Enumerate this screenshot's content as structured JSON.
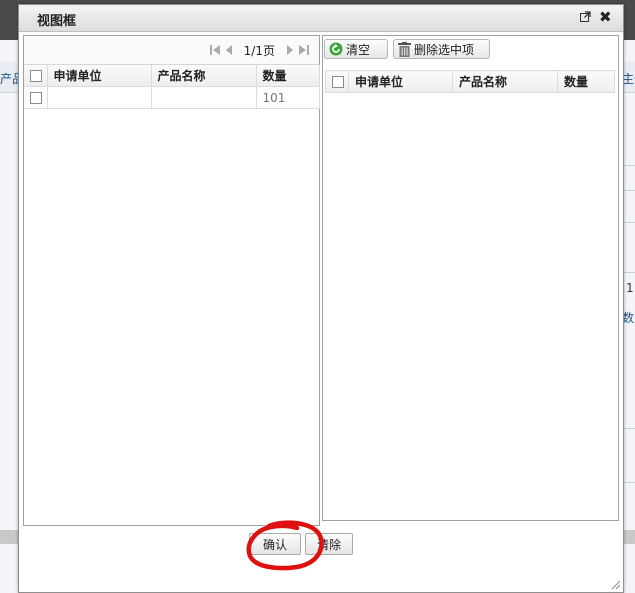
{
  "background": {
    "left_fragment": "产品",
    "right_fragment_1": "主信",
    "right_fragment_2": "1",
    "right_fragment_3": "数量"
  },
  "dialog": {
    "title": "视图框"
  },
  "left_panel": {
    "pager": {
      "info": "1/1页"
    },
    "columns": [
      "申请单位",
      "产品名称",
      "数量"
    ],
    "rows": [
      {
        "unit": "",
        "product": "",
        "qty": "101"
      }
    ]
  },
  "right_panel": {
    "toolbar": {
      "clear_label": "清空",
      "delete_selected_label": "删除选中项"
    },
    "columns": [
      "申请单位",
      "产品名称",
      "数量"
    ]
  },
  "footer": {
    "confirm_label": "确认",
    "clear_label": "清除"
  },
  "colors": {
    "annotation_circle": "#e01010",
    "clear_icon": "#3aa33a"
  }
}
